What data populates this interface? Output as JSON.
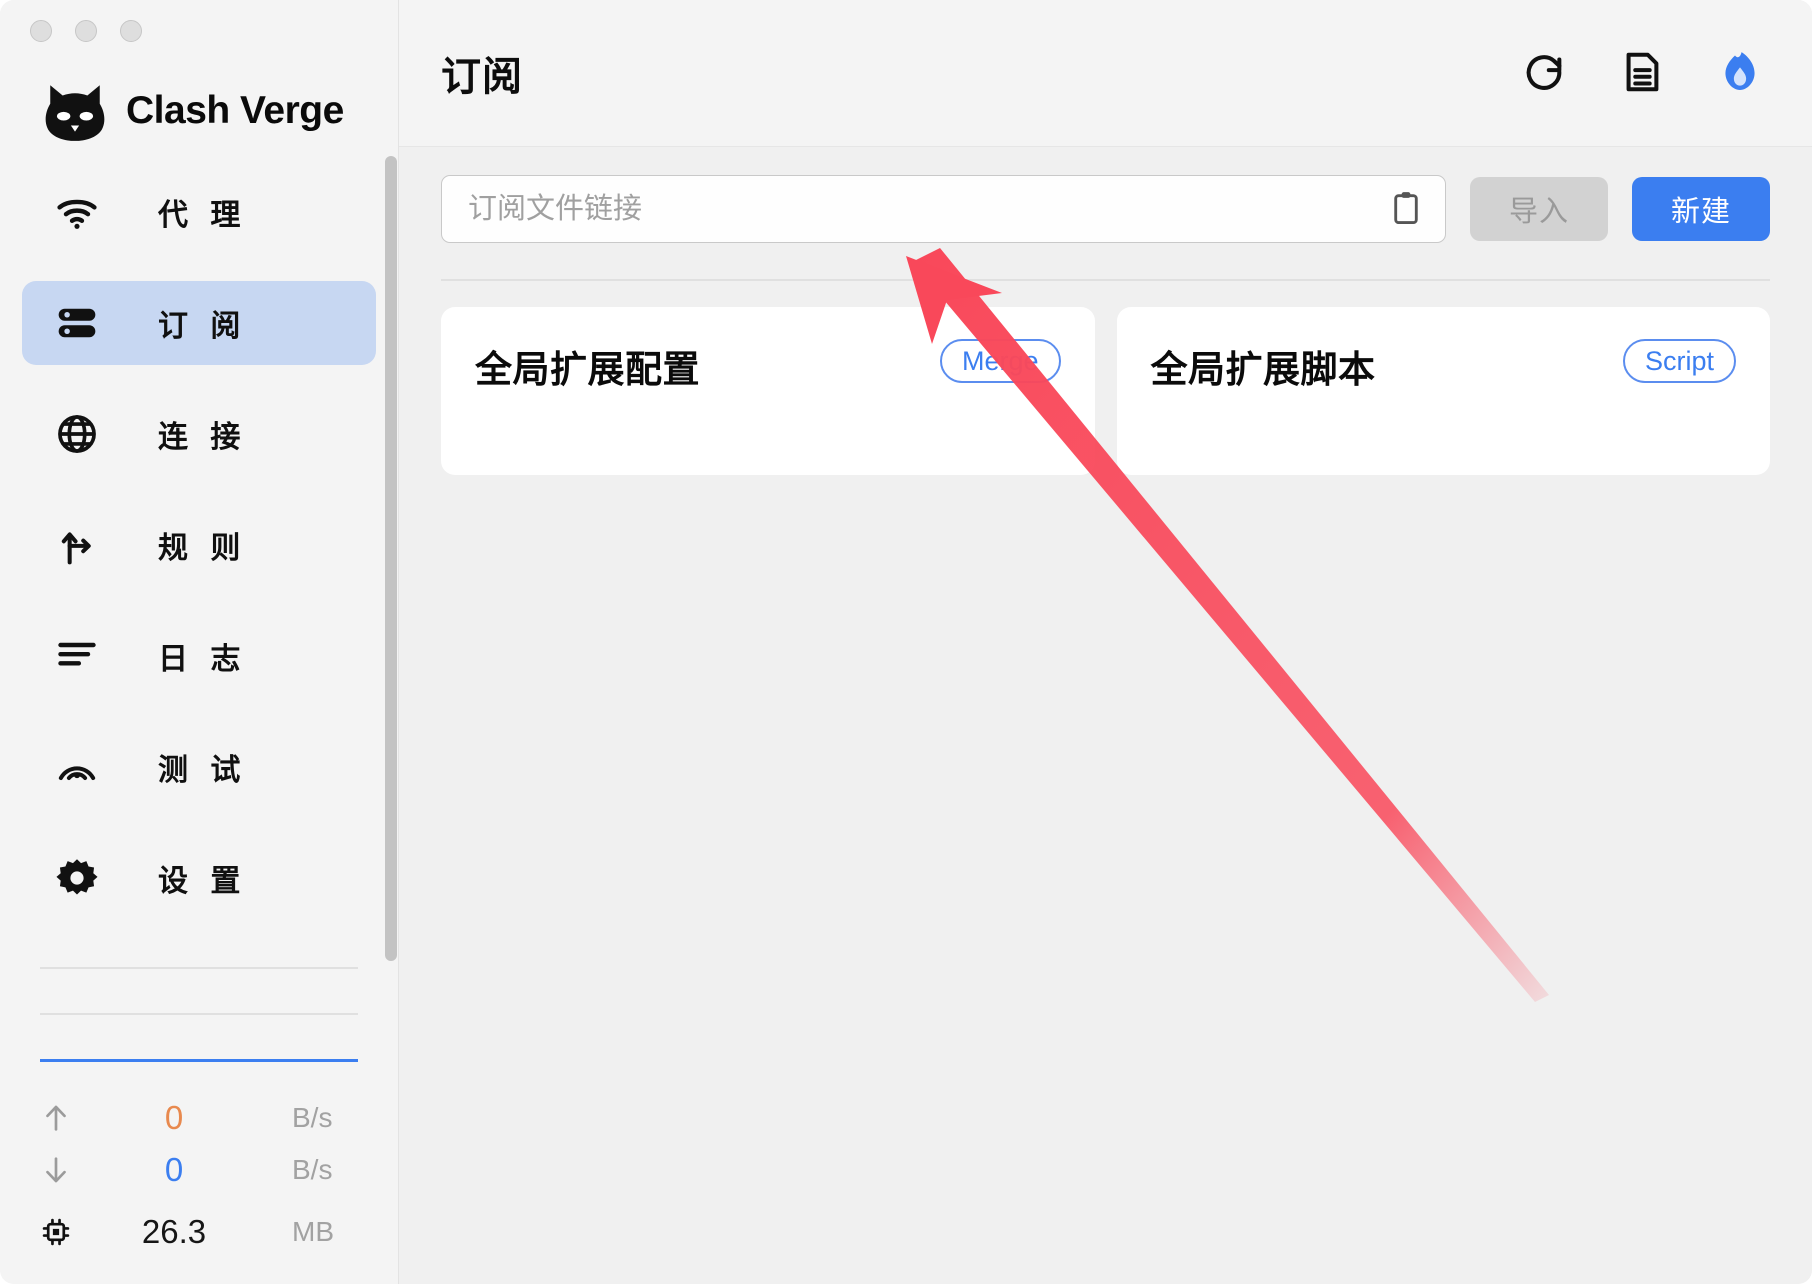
{
  "window": {
    "traffic_lights": [
      "close",
      "minimize",
      "maximize"
    ]
  },
  "brand": {
    "name": "Clash Verge",
    "logo_icon": "cat-logo-icon"
  },
  "sidebar": {
    "items": [
      {
        "label": "代 理",
        "icon": "wifi-icon",
        "key": "proxy",
        "active": false
      },
      {
        "label": "订 阅",
        "icon": "server-icon",
        "key": "profile",
        "active": true
      },
      {
        "label": "连 接",
        "icon": "globe-icon",
        "key": "connect",
        "active": false
      },
      {
        "label": "规 则",
        "icon": "fork-icon",
        "key": "rules",
        "active": false
      },
      {
        "label": "日 志",
        "icon": "list-icon",
        "key": "logs",
        "active": false
      },
      {
        "label": "测 试",
        "icon": "radar-icon",
        "key": "test",
        "active": false
      },
      {
        "label": "设 置",
        "icon": "gear-icon",
        "key": "settings",
        "active": false
      }
    ],
    "stats": [
      {
        "icon": "arrow-up-icon",
        "value": "0",
        "unit": "B/s",
        "color": "#e8894e"
      },
      {
        "icon": "arrow-down-icon",
        "value": "0",
        "unit": "B/s",
        "color": "#3b7ef0"
      },
      {
        "icon": "memory-chip-icon",
        "value": "26.3",
        "unit": "MB",
        "color": "#161616"
      }
    ]
  },
  "topbar": {
    "title": "订阅",
    "actions": [
      {
        "name": "refresh-icon",
        "label": "refresh"
      },
      {
        "name": "document-icon",
        "label": "document"
      },
      {
        "name": "flame-icon",
        "label": "flame"
      }
    ]
  },
  "url_bar": {
    "placeholder": "订阅文件链接",
    "value": "",
    "paste_icon": "clipboard-icon",
    "import_label": "导入",
    "import_disabled": true,
    "new_label": "新建"
  },
  "cards": [
    {
      "title": "全局扩展配置",
      "badge": "Merge",
      "has_console_icon": false
    },
    {
      "title": "全局扩展脚本",
      "badge": "Script",
      "has_console_icon": true
    }
  ],
  "annotation": {
    "type": "arrow",
    "color": "#f9485a",
    "points_to": "url-input"
  },
  "colors": {
    "accent": "#3b7ef0",
    "sidebar_active_bg": "#c7d7f2",
    "background": "#f0f0f0",
    "sidebar_bg": "#f4f4f4",
    "card_bg": "#ffffff",
    "annotation_red": "#f9485a"
  }
}
